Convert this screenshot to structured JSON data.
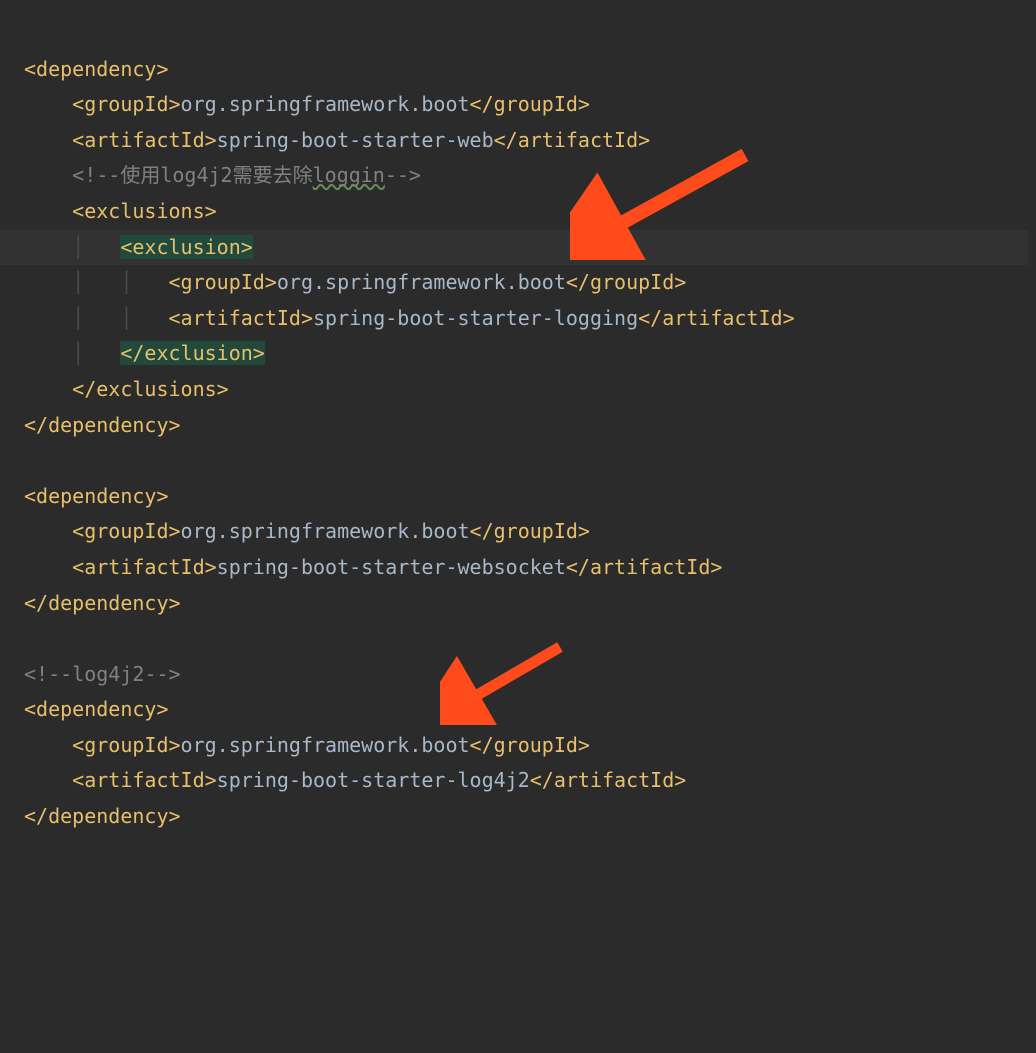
{
  "tags": {
    "dependency_open": "<dependency>",
    "dependency_close": "</dependency>",
    "groupId_open": "<groupId>",
    "groupId_close": "</groupId>",
    "artifactId_open": "<artifactId>",
    "artifactId_close": "</artifactId>",
    "exclusions_open": "<exclusions>",
    "exclusions_close": "</exclusions>",
    "exclusion_open": "<exclusion>",
    "exclusion_close": "</exclusion>"
  },
  "values": {
    "group_spring_boot": "org.springframework.boot",
    "artifact_web": "spring-boot-starter-web",
    "artifact_logging": "spring-boot-starter-logging",
    "artifact_websocket": "spring-boot-starter-websocket",
    "artifact_log4j2": "spring-boot-starter-log4j2"
  },
  "comments": {
    "c1_open": "<!--",
    "c1_text_a": "使用log4j2需要去除",
    "c1_text_b": "loggin",
    "c1_close": "-->",
    "c2": "<!--log4j2-->"
  },
  "guides": {
    "one": "│   ",
    "two": "│   │   "
  }
}
